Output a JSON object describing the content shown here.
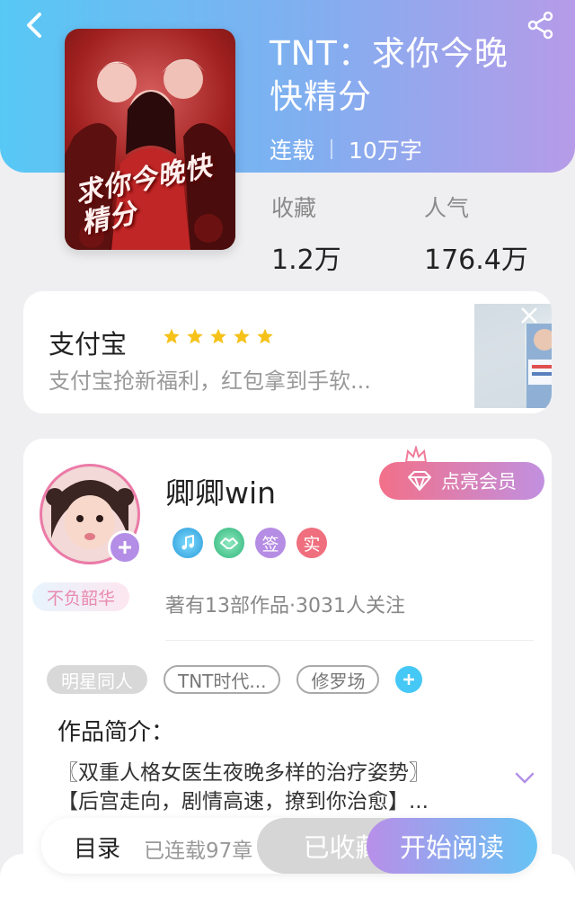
{
  "book": {
    "title": "TNT：求你今晚快精分",
    "cover_text": "求你今晚快精分",
    "status": "连载",
    "word_count": "10万字",
    "stats": [
      {
        "label": "收藏",
        "value": "1.2万"
      },
      {
        "label": "人气",
        "value": "176.4万"
      }
    ]
  },
  "ad": {
    "name": "支付宝",
    "rating": 5,
    "description": "支付宝抢新福利，红包拿到手软..."
  },
  "author": {
    "name": "卿卿win",
    "vip_label": "点亮会员",
    "title_badge": "不负韶华",
    "badges": [
      "签",
      "实"
    ],
    "stats": "著有13部作品·3031人关注"
  },
  "tags": [
    "明星同人",
    "TNT时代...",
    "修罗场"
  ],
  "intro": {
    "heading": "作品简介：",
    "line1": "〖双重人格女医生夜晚多样的治疗姿势〗",
    "line2": "【后宫走向，剧情高速，撩到你治愈】..."
  },
  "bottom_bar": {
    "toc": "目录",
    "chapters": "已连载97章",
    "collected": "已收藏",
    "read": "开始阅读"
  },
  "colors": {
    "header_start": "#57c8f5",
    "header_end": "#b69be8",
    "star": "#f6c21a",
    "vip_start": "#f27089",
    "read_start": "#b88fe9",
    "read_end": "#66c3f4"
  }
}
